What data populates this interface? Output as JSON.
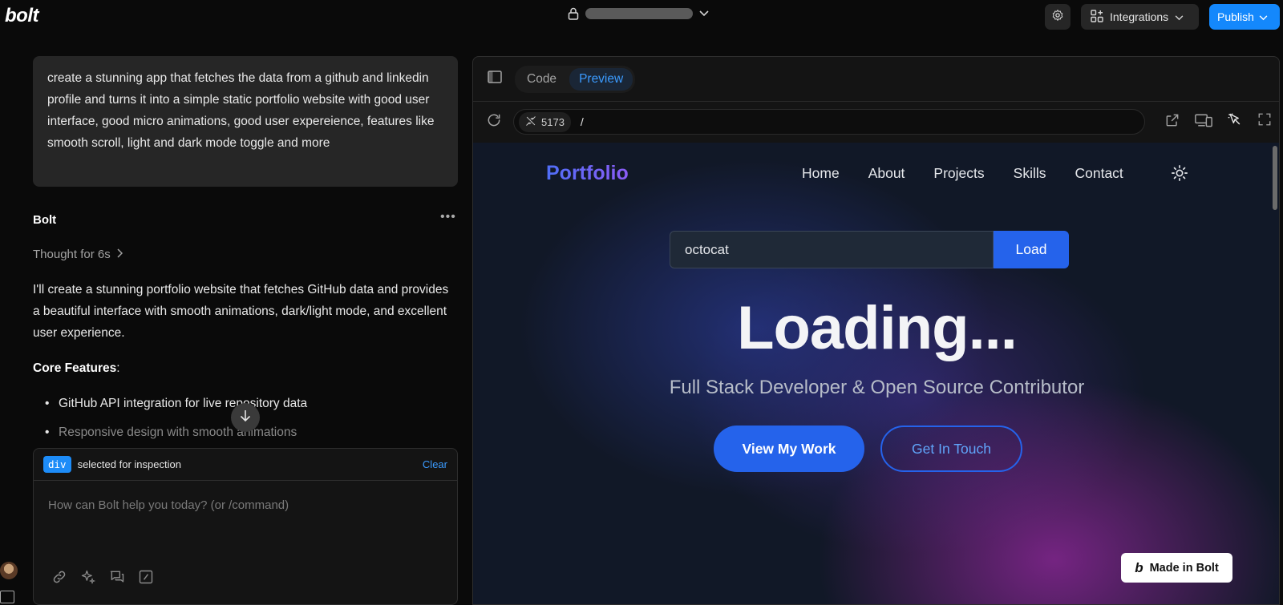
{
  "app": {
    "logo": "bolt"
  },
  "topbar": {
    "integrations_label": "Integrations",
    "publish_label": "Publish"
  },
  "chat": {
    "user_message": "create a stunning app that fetches the data from a github and linkedin profile and turns it into a simple static portfolio website with good user interface, good micro animations, good user expereience, features like smooth scroll, light and dark mode toggle and more",
    "assistant_name": "Bolt",
    "menu_dots": "•••",
    "thought": "Thought for 6s",
    "response": "I'll create a stunning portfolio website that fetches GitHub data and provides a beautiful interface with smooth animations, dark/light mode, and excellent user experience.",
    "core_features_title": "Core Features",
    "core_features_colon": ":",
    "bullets": [
      "GitHub API integration for live repository data",
      "Responsive design with smooth animations"
    ]
  },
  "composer": {
    "tag": "div",
    "inspect_text": "selected for inspection",
    "clear_label": "Clear",
    "placeholder": "How can Bolt help you today? (or /command)"
  },
  "preview": {
    "tabs": [
      {
        "label": "Code",
        "active": false
      },
      {
        "label": "Preview",
        "active": true
      }
    ],
    "port": "5173",
    "path": "/",
    "site": {
      "brand": "Portfolio",
      "nav": [
        "Home",
        "About",
        "Projects",
        "Skills",
        "Contact"
      ],
      "search_value": "octocat",
      "load_label": "Load",
      "headline": "Loading...",
      "tagline": "Full Stack Developer & Open Source Contributor",
      "cta_primary": "View My Work",
      "cta_secondary": "Get In Touch",
      "made_in": "Made in Bolt",
      "made_in_logo": "b"
    }
  },
  "colors": {
    "accent": "#1488fc",
    "site_primary": "#2563eb",
    "background": "#0a0a0a"
  }
}
